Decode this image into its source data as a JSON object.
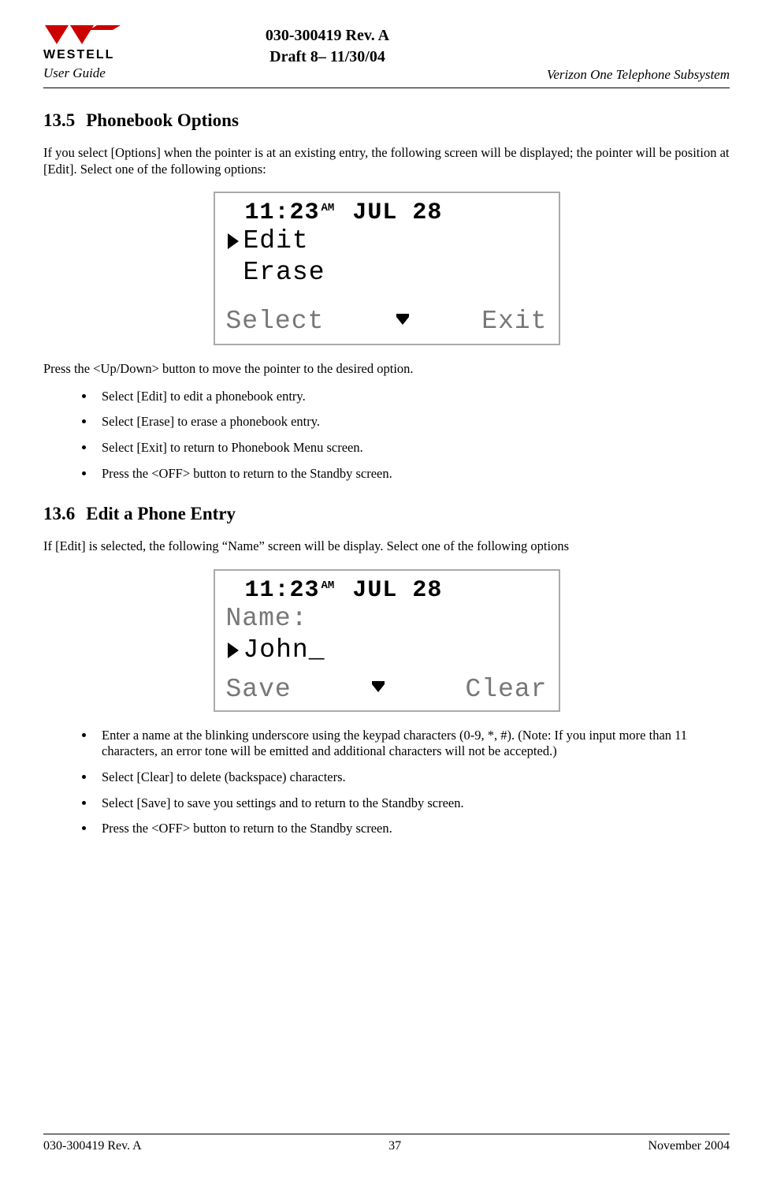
{
  "header": {
    "doc_number": "030-300419 Rev. A",
    "draft_line": "Draft 8– 11/30/04",
    "left_sub": "User Guide",
    "right_sub": "Verizon One Telephone Subsystem",
    "logo_text": "WESTELL"
  },
  "sections": {
    "s1": {
      "num": "13.5",
      "title": "Phonebook Options"
    },
    "s2": {
      "num": "13.6",
      "title": "Edit a Phone Entry"
    }
  },
  "paras": {
    "p1": "If you select [Options] when the pointer is at an existing entry, the following screen will be displayed; the pointer will be position at [Edit]. Select one of the following options:",
    "p2": "Press the <Up/Down> button to move the pointer to the desired option.",
    "p3": "If [Edit] is selected, the following “Name” screen will be display. Select one of the following options"
  },
  "bullets1": [
    "Select [Edit] to edit a phonebook entry.",
    "Select [Erase] to erase a phonebook entry.",
    "Select [Exit] to return to Phonebook Menu screen.",
    "Press the <OFF> button to return to the Standby screen."
  ],
  "bullets2": [
    "Enter a name at the blinking underscore using the keypad characters (0-9, *, #). (Note: If you input more than 11 characters, an error tone will be emitted and additional characters will not be accepted.)",
    "Select [Clear] to delete (backspace) characters.",
    "Select [Save] to save you settings and to return to the Standby screen.",
    "Press the <OFF> button to return to the Standby screen."
  ],
  "lcd1": {
    "time": "11:23",
    "ampm": "AM",
    "date": "JUL 28",
    "row1": "Edit",
    "row2": "Erase",
    "left": "Select",
    "right": "Exit"
  },
  "lcd2": {
    "time": "11:23",
    "ampm": "AM",
    "date": "JUL 28",
    "row1": "Name:",
    "row2": "John_",
    "left": "Save",
    "right": "Clear"
  },
  "footer": {
    "left": "030-300419 Rev. A",
    "center": "37",
    "right": "November 2004"
  }
}
